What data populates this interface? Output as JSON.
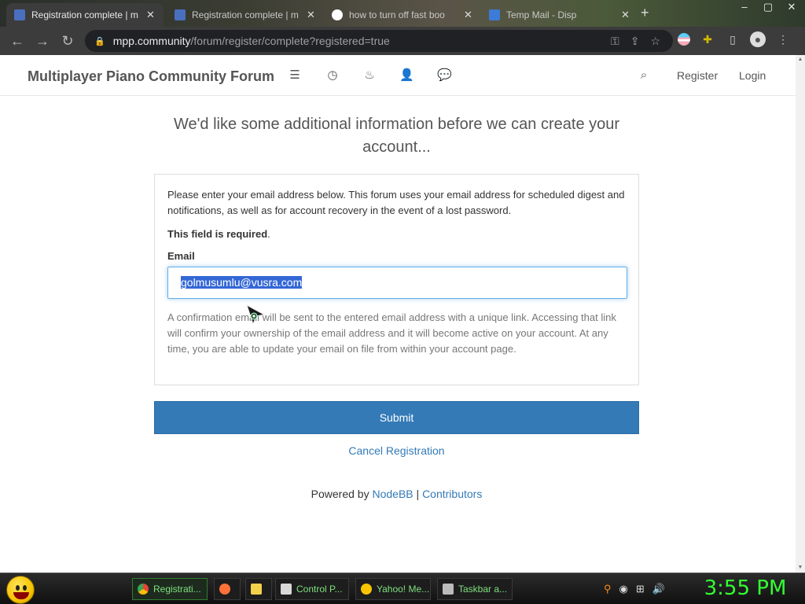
{
  "browser": {
    "tabs": [
      {
        "title": "Registration complete | m",
        "favicon_color": "#4a6fbf",
        "active": true
      },
      {
        "title": "Registration complete | m",
        "favicon_color": "#4a6fbf",
        "active": false
      },
      {
        "title": "how to turn off fast boo",
        "favicon_color": "#ffffff",
        "active": false
      },
      {
        "title": "Temp Mail - Disp",
        "favicon_color": "#3d7bd9",
        "active": false
      }
    ],
    "close_glyph": "✕",
    "new_tab_glyph": "+",
    "url_host": "mpp.community",
    "url_path": "/forum/register/complete?registered=true"
  },
  "forum": {
    "brand": "Multiplayer Piano Community Forum",
    "nav_icons": [
      "list-icon",
      "clock-icon",
      "fire-icon",
      "user-icon",
      "comments-icon"
    ],
    "register": "Register",
    "login": "Login"
  },
  "main": {
    "lead": "We'd like some additional information before we can create your account...",
    "intro": "Please enter your email address below. This forum uses your email address for scheduled digest and notifications, as well as for account recovery in the event of a lost password.",
    "required": "This field is required",
    "required_period": ".",
    "email_label": "Email",
    "email_value": "golmusumlu@vusra.com",
    "help": "A confirmation email will be sent to the entered email address with a unique link. Accessing that link will confirm your ownership of the email address and it will become active on your account. At any time, you are able to update your email on file from within your account page.",
    "submit": "Submit",
    "cancel": "Cancel Registration"
  },
  "footer": {
    "powered_by": "Powered by",
    "nodebb": "NodeBB",
    "separator": "|",
    "contributors": "Contributors"
  },
  "taskbar": {
    "tasks": [
      {
        "label": "Registrati...",
        "icon_color": "#34a853",
        "active": true
      },
      {
        "label": "",
        "icon_color": "#ff7139",
        "active": false
      },
      {
        "label": "",
        "icon_color": "#f2d24b",
        "active": false
      },
      {
        "label": "Control P...",
        "icon_color": "#d9d9d9",
        "active": false
      },
      {
        "label": "Yahoo! Me...",
        "icon_color": "#f6c400",
        "active": false
      },
      {
        "label": "Taskbar a...",
        "icon_color": "#bbbbbb",
        "active": false
      }
    ],
    "clock": "3:55 PM"
  },
  "colors": {
    "link": "#337ab7",
    "submit_bg": "#337ab7",
    "clock": "#33ff33",
    "selection": "#3367d6"
  }
}
